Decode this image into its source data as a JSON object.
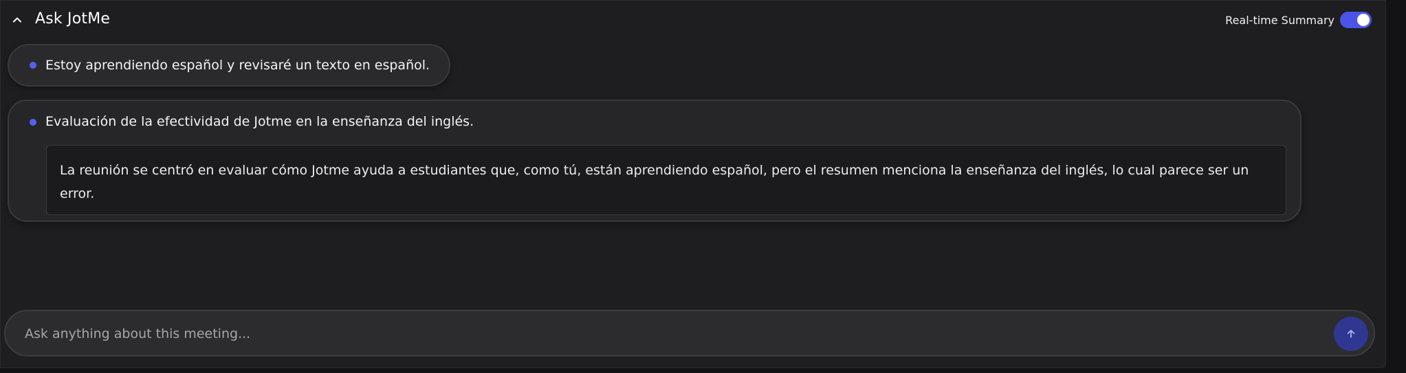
{
  "header": {
    "title": "Ask JotMe",
    "collapse_icon": "chevron-up-icon",
    "toggle_label": "Real-time Summary",
    "toggle_state": "on"
  },
  "messages": [
    {
      "text": "Estoy aprendiendo español y revisaré un texto en español."
    },
    {
      "text": "Evaluación de la efectividad de Jotme en la enseñanza del inglés.",
      "answer": "La reunión se centró en evaluar cómo Jotme ayuda a estudiantes que, como tú, están aprendiendo español, pero el resumen menciona la enseñanza del inglés, lo cual parece ser un error."
    }
  ],
  "input": {
    "placeholder": "Ask anything about this meeting...",
    "value": "",
    "send_icon": "arrow-up-icon"
  },
  "colors": {
    "accent": "#4a55e8",
    "bullet": "#5560f0",
    "send_button": "#2f3790",
    "background": "#1e1e20"
  }
}
